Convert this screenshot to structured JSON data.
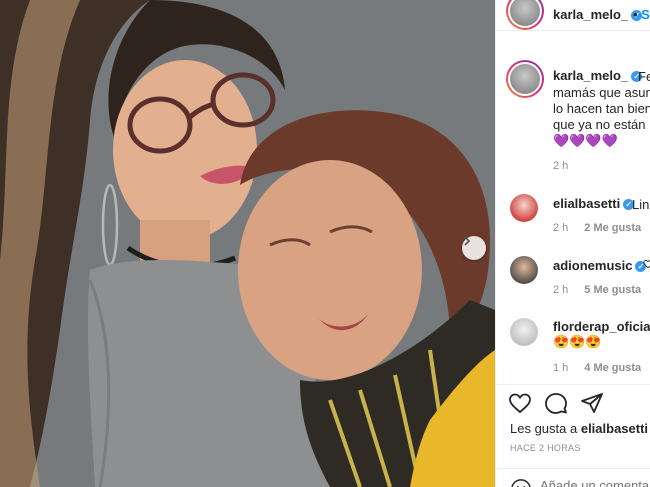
{
  "post_author": {
    "username": "karla_melo_",
    "verified": true,
    "follow_label": "S"
  },
  "caption": {
    "username": "karla_melo_",
    "lines": [
      "Fe",
      "mamás que asum",
      "lo hacen tan bien!",
      "que ya no están"
    ],
    "emoji": "💜💜💜💜",
    "time": "2 h"
  },
  "comments": [
    {
      "username": "elialbasetti",
      "verified": true,
      "text": "Lin",
      "time": "2 h",
      "likes": "2 Me gusta"
    },
    {
      "username": "adionemusic",
      "verified": true,
      "text": "",
      "time": "2 h",
      "likes": "5 Me gusta"
    },
    {
      "username": "florderap_oficial_",
      "verified": false,
      "text": "😍😍😍",
      "time": "1 h",
      "likes": "4 Me gusta"
    }
  ],
  "likes": {
    "prefix": "Les gusta a",
    "user": "elialbasetti",
    "suffix": "y"
  },
  "time_ago": "HACE 2 HORAS",
  "add_comment": {
    "placeholder": "Añade un comentario..."
  },
  "icons": {
    "next": "chevron-right-icon",
    "like": "heart-icon",
    "comment": "comment-icon",
    "share": "share-icon",
    "emoji": "emoji-icon"
  },
  "colors": {
    "link": "#0095f6",
    "verified": "#3897f0",
    "muted": "#8e8e8e",
    "text": "#262626"
  }
}
